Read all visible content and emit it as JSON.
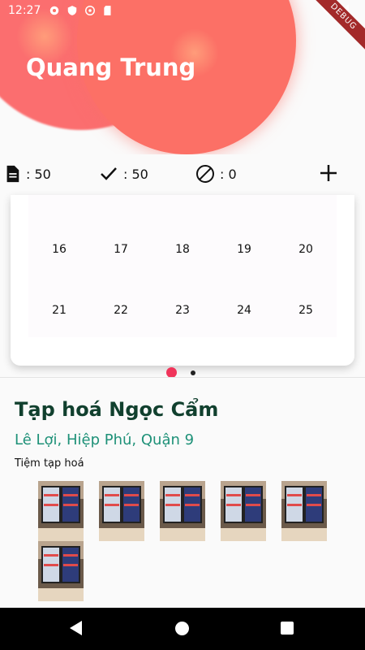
{
  "status": {
    "time": "12:27"
  },
  "debug_banner": "DEBUG",
  "header": {
    "title": "Quang Trung"
  },
  "stats": {
    "documents": ": 50",
    "done": ": 50",
    "blocked": ": 0"
  },
  "calendar": {
    "rows": [
      [
        "16",
        "17",
        "18",
        "19",
        "20"
      ],
      [
        "21",
        "22",
        "23",
        "24",
        "25"
      ]
    ]
  },
  "shop": {
    "name": "Tạp hoá Ngọc Cẩm",
    "address": "Lê Lợi, Hiệp Phú, Quận 9",
    "type": "Tiệm tạp hoá"
  },
  "colors": {
    "header_accent": "#fc7066",
    "shop_name": "#11402e",
    "address": "#1e9178",
    "page_dot_active": "#f0345a"
  },
  "icons": {
    "documents": "document-icon",
    "done": "check-icon",
    "blocked": "block-icon",
    "add": "plus-icon"
  }
}
